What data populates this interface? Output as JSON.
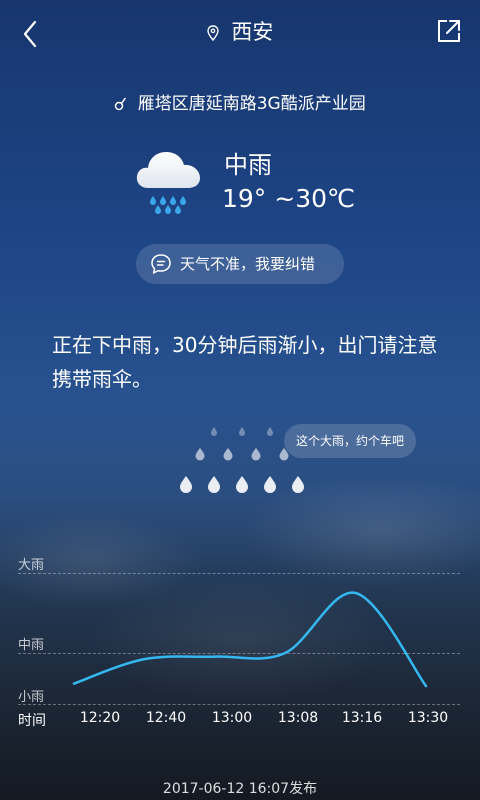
{
  "header": {
    "city": "西安",
    "back_icon": "chevron-left-icon",
    "share_icon": "share-external-icon",
    "location_icon": "location-pin-icon"
  },
  "location": {
    "address": "雁塔区唐延南路3G酷派产业园",
    "icon": "navigation-arrow-icon"
  },
  "current": {
    "condition": "中雨",
    "temperature": "19°  ~30℃",
    "icon": "cloud-rain-icon"
  },
  "feedback": {
    "label": "天气不准，我要纠错",
    "icon": "chat-bubble-icon"
  },
  "forecast_text": "正在下中雨，30分钟后雨渐小，出门请注意携带雨伞。",
  "rain_animation": {
    "tip": "这个大雨，约个车吧",
    "icon": "raindrops-icon"
  },
  "chart_data": {
    "type": "line",
    "y_levels": [
      "大雨",
      "中雨",
      "小雨"
    ],
    "x_title": "时间",
    "x": [
      "12:20",
      "12:40",
      "13:00",
      "13:08",
      "13:16",
      "13:30"
    ],
    "series": [
      {
        "values": [
          1.4,
          1.88,
          1.93,
          2.0,
          2.75,
          1.35
        ]
      }
    ],
    "ylim": [
      1,
      3
    ],
    "line_color": "#35b8f0"
  },
  "publish_time": "2017-06-12 16:07发布"
}
